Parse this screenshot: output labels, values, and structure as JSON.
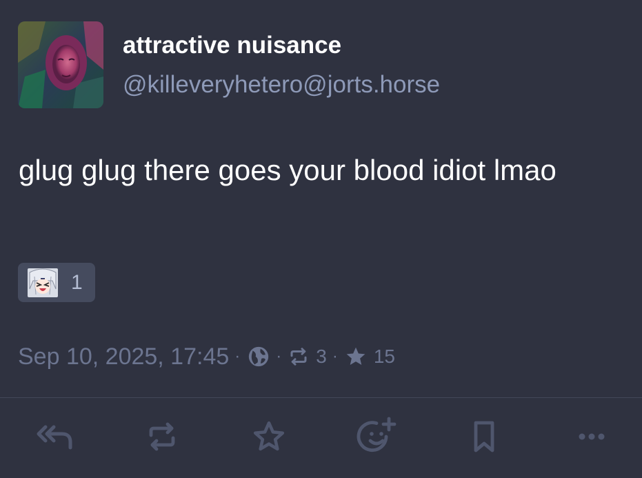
{
  "post": {
    "author": {
      "display_name": "attractive nuisance",
      "handle": "@killeveryhetero@jorts.horse",
      "avatar_icon": "profile-photo"
    },
    "content": "glug glug there goes your blood idiot lmao",
    "reactions": [
      {
        "emoji_icon": "anime-girl-laughing-emoji",
        "count": "1"
      }
    ],
    "meta": {
      "timestamp": "Sep 10, 2025, 17:45",
      "separator": "·",
      "visibility_icon": "globe-icon",
      "boost_icon": "boost-icon",
      "boosts": "3",
      "favourite_icon": "star-icon",
      "favourites": "15"
    }
  },
  "actions": [
    {
      "name": "reply-all",
      "icon": "reply-all-icon"
    },
    {
      "name": "boost",
      "icon": "boost-icon"
    },
    {
      "name": "favourite",
      "icon": "star-outline-icon"
    },
    {
      "name": "add-reaction",
      "icon": "emoji-add-icon"
    },
    {
      "name": "bookmark",
      "icon": "bookmark-icon"
    },
    {
      "name": "more",
      "icon": "more-dots-icon"
    }
  ],
  "colors": {
    "background": "#2f3240",
    "text": "#ffffff",
    "handle": "#8e9ab8",
    "muted": "#6c7590",
    "reaction_bg": "#454b5e",
    "action_icon": "#4f566d"
  }
}
